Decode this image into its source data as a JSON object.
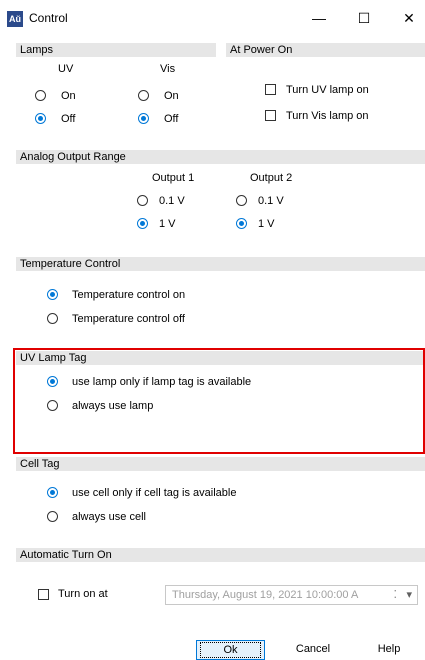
{
  "window": {
    "app_icon_text": "Aŭ",
    "title": "Control",
    "minimize_glyph": "—",
    "maximize_glyph": "☐",
    "close_glyph": "✕"
  },
  "lamps": {
    "header": "Lamps",
    "uv_label": "UV",
    "vis_label": "Vis",
    "uv_on": "On",
    "uv_off": "Off",
    "vis_on": "On",
    "vis_off": "Off",
    "uv_selected": "Off",
    "vis_selected": "Off"
  },
  "power_on": {
    "header": "At Power On",
    "turn_uv": "Turn UV lamp on",
    "turn_vis": "Turn Vis lamp on",
    "turn_uv_checked": false,
    "turn_vis_checked": false
  },
  "analog": {
    "header": "Analog Output Range",
    "output1": "Output 1",
    "output2": "Output 2",
    "o1_opt1": "0.1 V",
    "o1_opt2": "1 V",
    "o2_opt1": "0.1 V",
    "o2_opt2": "1 V",
    "output1_selected": "1 V",
    "output2_selected": "1 V"
  },
  "temperature": {
    "header": "Temperature Control",
    "on": "Temperature control on",
    "off": "Temperature control off",
    "selected": "Temperature control on"
  },
  "uv_lamp_tag": {
    "header": "UV Lamp Tag",
    "opt1": "use lamp only if lamp tag is available",
    "opt2": "always use lamp",
    "selected": "use lamp only if lamp tag is available"
  },
  "cell_tag": {
    "header": "Cell Tag",
    "opt1": "use cell only if cell tag is available",
    "opt2": "always use cell",
    "selected": "use cell only if cell tag is available"
  },
  "auto_turn_on": {
    "header": "Automatic Turn On",
    "checkbox_label": "Turn on at",
    "checked": false,
    "datetime_value": "Thursday, August 19, 2021   10:00:00 A",
    "spin_glyph": "⁚",
    "dropdown_glyph": "▾"
  },
  "buttons": {
    "ok": "Ok",
    "cancel": "Cancel",
    "help": "Help"
  },
  "colors": {
    "accent": "#0078d7",
    "section_header_bg": "#e6e6e6",
    "highlight_border": "#e00000"
  }
}
